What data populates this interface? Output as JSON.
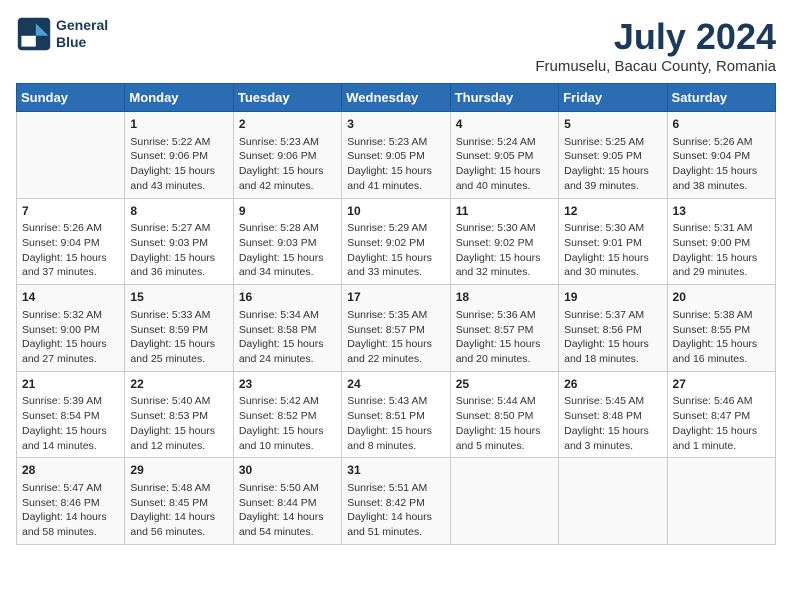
{
  "logo": {
    "line1": "General",
    "line2": "Blue"
  },
  "title": "July 2024",
  "subtitle": "Frumuselu, Bacau County, Romania",
  "headers": [
    "Sunday",
    "Monday",
    "Tuesday",
    "Wednesday",
    "Thursday",
    "Friday",
    "Saturday"
  ],
  "weeks": [
    [
      {
        "day": "",
        "content": ""
      },
      {
        "day": "1",
        "content": "Sunrise: 5:22 AM\nSunset: 9:06 PM\nDaylight: 15 hours\nand 43 minutes."
      },
      {
        "day": "2",
        "content": "Sunrise: 5:23 AM\nSunset: 9:06 PM\nDaylight: 15 hours\nand 42 minutes."
      },
      {
        "day": "3",
        "content": "Sunrise: 5:23 AM\nSunset: 9:05 PM\nDaylight: 15 hours\nand 41 minutes."
      },
      {
        "day": "4",
        "content": "Sunrise: 5:24 AM\nSunset: 9:05 PM\nDaylight: 15 hours\nand 40 minutes."
      },
      {
        "day": "5",
        "content": "Sunrise: 5:25 AM\nSunset: 9:05 PM\nDaylight: 15 hours\nand 39 minutes."
      },
      {
        "day": "6",
        "content": "Sunrise: 5:26 AM\nSunset: 9:04 PM\nDaylight: 15 hours\nand 38 minutes."
      }
    ],
    [
      {
        "day": "7",
        "content": "Sunrise: 5:26 AM\nSunset: 9:04 PM\nDaylight: 15 hours\nand 37 minutes."
      },
      {
        "day": "8",
        "content": "Sunrise: 5:27 AM\nSunset: 9:03 PM\nDaylight: 15 hours\nand 36 minutes."
      },
      {
        "day": "9",
        "content": "Sunrise: 5:28 AM\nSunset: 9:03 PM\nDaylight: 15 hours\nand 34 minutes."
      },
      {
        "day": "10",
        "content": "Sunrise: 5:29 AM\nSunset: 9:02 PM\nDaylight: 15 hours\nand 33 minutes."
      },
      {
        "day": "11",
        "content": "Sunrise: 5:30 AM\nSunset: 9:02 PM\nDaylight: 15 hours\nand 32 minutes."
      },
      {
        "day": "12",
        "content": "Sunrise: 5:30 AM\nSunset: 9:01 PM\nDaylight: 15 hours\nand 30 minutes."
      },
      {
        "day": "13",
        "content": "Sunrise: 5:31 AM\nSunset: 9:00 PM\nDaylight: 15 hours\nand 29 minutes."
      }
    ],
    [
      {
        "day": "14",
        "content": "Sunrise: 5:32 AM\nSunset: 9:00 PM\nDaylight: 15 hours\nand 27 minutes."
      },
      {
        "day": "15",
        "content": "Sunrise: 5:33 AM\nSunset: 8:59 PM\nDaylight: 15 hours\nand 25 minutes."
      },
      {
        "day": "16",
        "content": "Sunrise: 5:34 AM\nSunset: 8:58 PM\nDaylight: 15 hours\nand 24 minutes."
      },
      {
        "day": "17",
        "content": "Sunrise: 5:35 AM\nSunset: 8:57 PM\nDaylight: 15 hours\nand 22 minutes."
      },
      {
        "day": "18",
        "content": "Sunrise: 5:36 AM\nSunset: 8:57 PM\nDaylight: 15 hours\nand 20 minutes."
      },
      {
        "day": "19",
        "content": "Sunrise: 5:37 AM\nSunset: 8:56 PM\nDaylight: 15 hours\nand 18 minutes."
      },
      {
        "day": "20",
        "content": "Sunrise: 5:38 AM\nSunset: 8:55 PM\nDaylight: 15 hours\nand 16 minutes."
      }
    ],
    [
      {
        "day": "21",
        "content": "Sunrise: 5:39 AM\nSunset: 8:54 PM\nDaylight: 15 hours\nand 14 minutes."
      },
      {
        "day": "22",
        "content": "Sunrise: 5:40 AM\nSunset: 8:53 PM\nDaylight: 15 hours\nand 12 minutes."
      },
      {
        "day": "23",
        "content": "Sunrise: 5:42 AM\nSunset: 8:52 PM\nDaylight: 15 hours\nand 10 minutes."
      },
      {
        "day": "24",
        "content": "Sunrise: 5:43 AM\nSunset: 8:51 PM\nDaylight: 15 hours\nand 8 minutes."
      },
      {
        "day": "25",
        "content": "Sunrise: 5:44 AM\nSunset: 8:50 PM\nDaylight: 15 hours\nand 5 minutes."
      },
      {
        "day": "26",
        "content": "Sunrise: 5:45 AM\nSunset: 8:48 PM\nDaylight: 15 hours\nand 3 minutes."
      },
      {
        "day": "27",
        "content": "Sunrise: 5:46 AM\nSunset: 8:47 PM\nDaylight: 15 hours\nand 1 minute."
      }
    ],
    [
      {
        "day": "28",
        "content": "Sunrise: 5:47 AM\nSunset: 8:46 PM\nDaylight: 14 hours\nand 58 minutes."
      },
      {
        "day": "29",
        "content": "Sunrise: 5:48 AM\nSunset: 8:45 PM\nDaylight: 14 hours\nand 56 minutes."
      },
      {
        "day": "30",
        "content": "Sunrise: 5:50 AM\nSunset: 8:44 PM\nDaylight: 14 hours\nand 54 minutes."
      },
      {
        "day": "31",
        "content": "Sunrise: 5:51 AM\nSunset: 8:42 PM\nDaylight: 14 hours\nand 51 minutes."
      },
      {
        "day": "",
        "content": ""
      },
      {
        "day": "",
        "content": ""
      },
      {
        "day": "",
        "content": ""
      }
    ]
  ]
}
